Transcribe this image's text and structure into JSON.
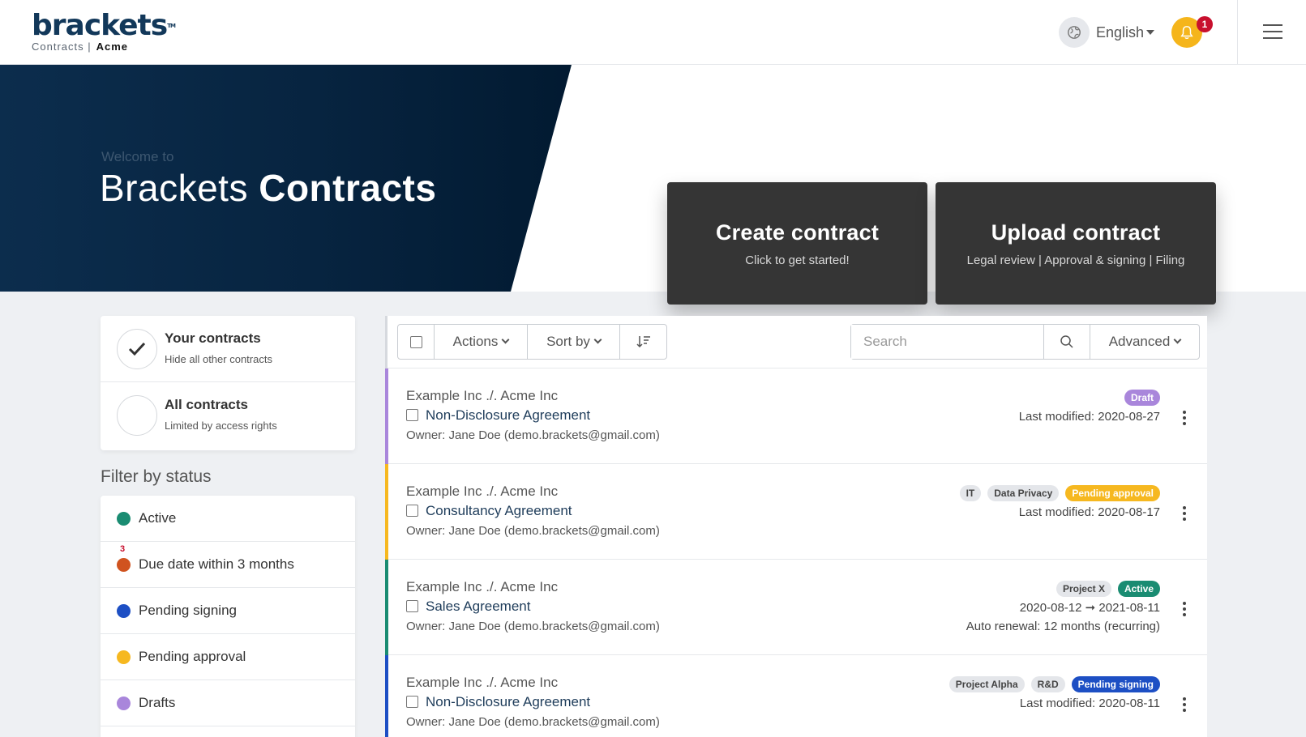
{
  "brand": {
    "wordmark": "brackets",
    "tm": "TM",
    "product": "Contracts |",
    "org": "Acme"
  },
  "header": {
    "language": "English",
    "notification_count": "1"
  },
  "hero": {
    "welcome": "Welcome to",
    "title_light": "Brackets",
    "title_bold": "Contracts",
    "create": {
      "title": "Create contract",
      "subtitle": "Click to get started!"
    },
    "upload": {
      "title": "Upload contract",
      "subtitle": "Legal review | Approval & signing | Filing"
    }
  },
  "scope": [
    {
      "title": "Your contracts",
      "subtitle": "Hide all other contracts",
      "selected": true
    },
    {
      "title": "All contracts",
      "subtitle": "Limited by access rights",
      "selected": false
    }
  ],
  "filter": {
    "heading": "Filter by status",
    "items": [
      {
        "label": "Active",
        "color": "#1a8c72",
        "count": ""
      },
      {
        "label": "Due date within 3 months",
        "color": "#d0531f",
        "count": "3"
      },
      {
        "label": "Pending signing",
        "color": "#1d4fc4",
        "count": ""
      },
      {
        "label": "Pending approval",
        "color": "#f6b820",
        "count": ""
      },
      {
        "label": "Drafts",
        "color": "#a986db",
        "count": ""
      }
    ]
  },
  "toolbar": {
    "actions": "Actions",
    "sort": "Sort by",
    "search_placeholder": "Search",
    "advanced": "Advanced"
  },
  "contracts": [
    {
      "parties": "Example Inc ./. Acme Inc",
      "name": "Non-Disclosure Agreement",
      "owner": "Owner: Jane Doe (demo.brackets@gmail.com)",
      "status": "Draft",
      "status_bg": "#a986db",
      "status_fg": "#ffffff",
      "bar": "#a986db",
      "tags": [],
      "meta": "Last modified: 2020-08-27",
      "meta2": ""
    },
    {
      "parties": "Example Inc ./. Acme Inc",
      "name": "Consultancy Agreement",
      "owner": "Owner: Jane Doe (demo.brackets@gmail.com)",
      "status": "Pending approval",
      "status_bg": "#f6b820",
      "status_fg": "#ffffff",
      "bar": "#f6b820",
      "tags": [
        "IT",
        "Data Privacy"
      ],
      "meta": "Last modified: 2020-08-17",
      "meta2": ""
    },
    {
      "parties": "Example Inc ./. Acme Inc",
      "name": "Sales Agreement",
      "owner": "Owner: Jane Doe (demo.brackets@gmail.com)",
      "status": "Active",
      "status_bg": "#1a8c72",
      "status_fg": "#ffffff",
      "bar": "#1a8c72",
      "tags": [
        "Project X"
      ],
      "meta": "2020-08-12 ➞ 2021-08-11",
      "meta2": "Auto renewal: 12 months (recurring)"
    },
    {
      "parties": "Example Inc ./. Acme Inc",
      "name": "Non-Disclosure Agreement",
      "owner": "Owner: Jane Doe (demo.brackets@gmail.com)",
      "status": "Pending signing",
      "status_bg": "#1d4fc4",
      "status_fg": "#ffffff",
      "bar": "#1d4fc4",
      "tags": [
        "Project Alpha",
        "R&D"
      ],
      "meta": "Last modified: 2020-08-11",
      "meta2": ""
    }
  ]
}
